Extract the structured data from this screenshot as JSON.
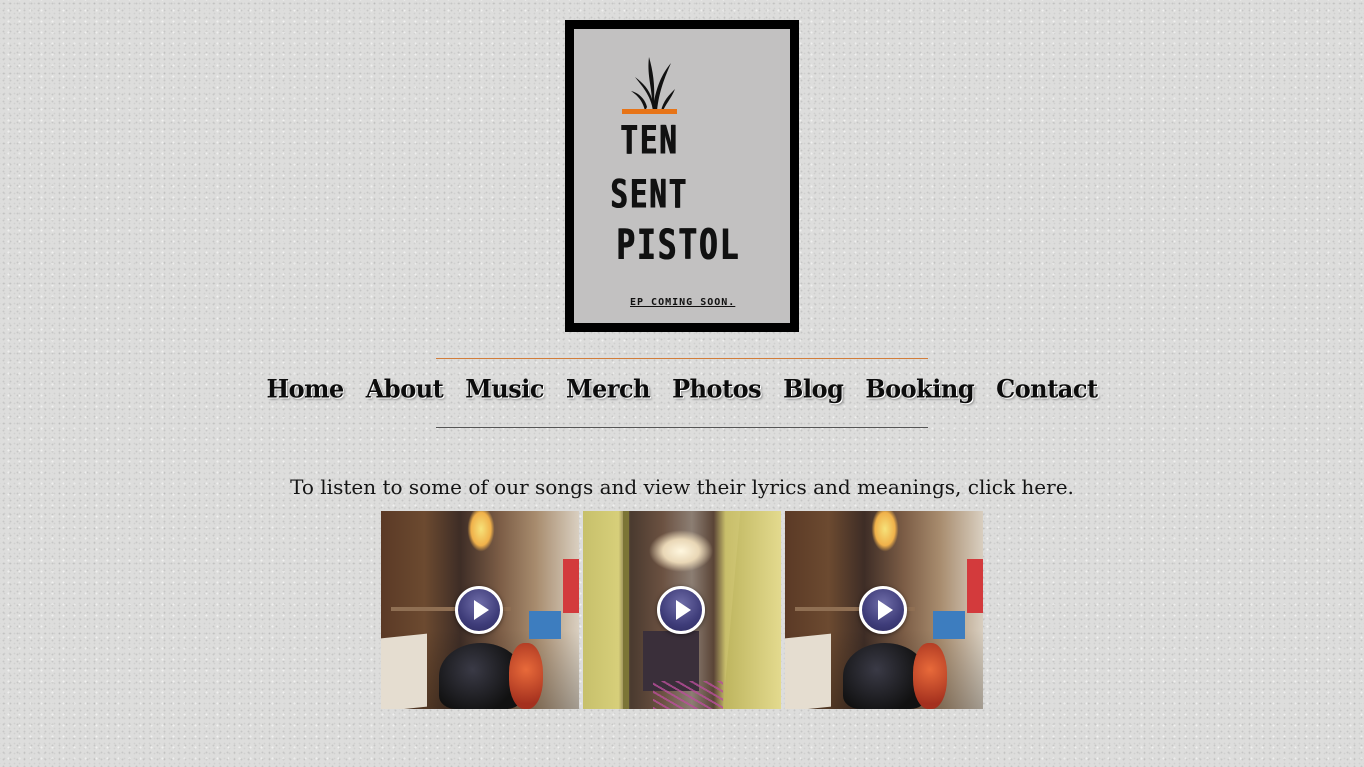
{
  "logo": {
    "line1": "TEN",
    "line2": "SENT",
    "line3": "PISTOL",
    "note": "EP COMING SOON.",
    "accent_color": "#e77417",
    "icon": "plant-icon"
  },
  "nav": {
    "items": [
      {
        "label": "Home"
      },
      {
        "label": "About"
      },
      {
        "label": "Music"
      },
      {
        "label": "Merch"
      },
      {
        "label": "Photos"
      },
      {
        "label": "Blog"
      },
      {
        "label": "Booking"
      },
      {
        "label": "Contact"
      }
    ]
  },
  "intro": {
    "text": "To listen to some of our songs and view their lyrics and meanings, ",
    "link": "click here",
    "end": "."
  },
  "videos": [
    {
      "icon": "play-icon"
    },
    {
      "icon": "play-icon"
    },
    {
      "icon": "play-icon"
    }
  ]
}
